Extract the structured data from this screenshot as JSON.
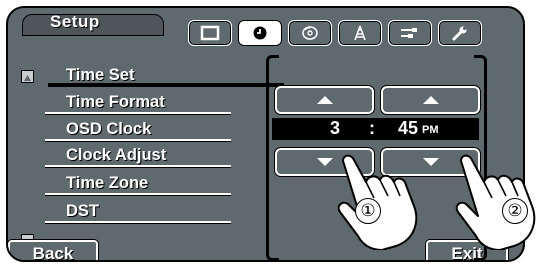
{
  "header": {
    "title": "Setup"
  },
  "tabs": [
    {
      "icon": "display-icon",
      "active": false
    },
    {
      "icon": "clock-icon",
      "active": true
    },
    {
      "icon": "disc-icon",
      "active": false
    },
    {
      "icon": "antenna-icon",
      "active": false
    },
    {
      "icon": "input-cable-icon",
      "active": false
    },
    {
      "icon": "wrench-icon",
      "active": false
    }
  ],
  "menu": {
    "items": [
      {
        "label": "Time Set",
        "selected": true
      },
      {
        "label": "Time Format",
        "selected": false
      },
      {
        "label": "OSD Clock",
        "selected": false
      },
      {
        "label": "Clock Adjust",
        "selected": false
      },
      {
        "label": "Time Zone",
        "selected": false
      },
      {
        "label": "DST",
        "selected": false
      }
    ]
  },
  "time": {
    "hour": "3",
    "separator": ":",
    "minutes": "45",
    "ampm": "PM"
  },
  "footer": {
    "back_label": "Back",
    "exit_label": "Exit"
  },
  "callouts": {
    "first": "①",
    "second": "②"
  },
  "colors": {
    "screen_bg": "#5e6a6d",
    "accent_text": "#ffffff",
    "time_bar": "#000000"
  }
}
